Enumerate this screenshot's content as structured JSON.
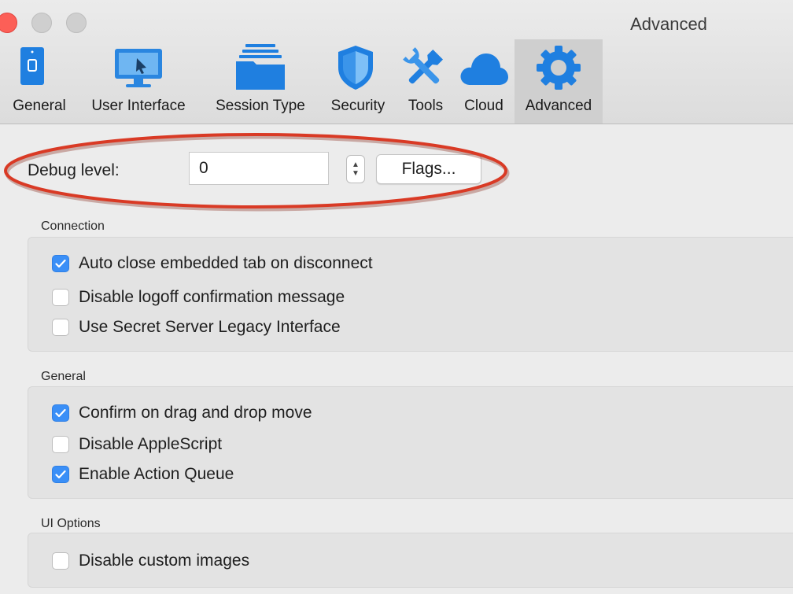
{
  "window": {
    "title": "Advanced"
  },
  "toolbar": {
    "tabs": [
      {
        "label": "General",
        "icon": "phone-icon"
      },
      {
        "label": "User Interface",
        "icon": "monitor-icon"
      },
      {
        "label": "Session Type",
        "icon": "folder-icon"
      },
      {
        "label": "Security",
        "icon": "shield-icon"
      },
      {
        "label": "Tools",
        "icon": "tools-icon"
      },
      {
        "label": "Cloud",
        "icon": "cloud-icon"
      },
      {
        "label": "Advanced",
        "icon": "gear-icon",
        "active": true
      }
    ]
  },
  "debug": {
    "label": "Debug level:",
    "value": "0",
    "flags_button": "Flags..."
  },
  "sections": {
    "connection": {
      "title": "Connection",
      "options": [
        {
          "label": "Auto close embedded tab on disconnect",
          "checked": true
        },
        {
          "label": "Disable logoff confirmation message",
          "checked": false
        },
        {
          "label": "Use Secret Server Legacy Interface",
          "checked": false
        }
      ]
    },
    "general": {
      "title": "General",
      "options": [
        {
          "label": "Confirm on drag and drop move",
          "checked": true
        },
        {
          "label": "Disable AppleScript",
          "checked": false
        },
        {
          "label": "Enable Action Queue",
          "checked": true
        }
      ]
    },
    "ui_options": {
      "title": "UI Options",
      "options": [
        {
          "label": "Disable custom images",
          "checked": false
        }
      ]
    }
  },
  "colors": {
    "accent": "#3a8ff7",
    "annotation": "#d93a25",
    "close": "#fc5f57"
  }
}
